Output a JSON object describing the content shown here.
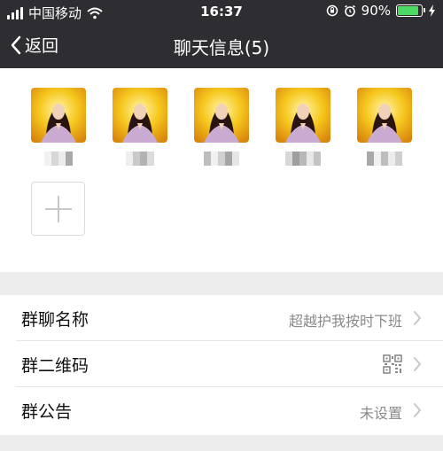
{
  "status_bar": {
    "carrier": "中国移动",
    "time": "16:37",
    "battery": "90%",
    "battery_level": 0.9,
    "icons": [
      "signal-icon",
      "wifi-icon",
      "rotation-lock-icon",
      "alarm-icon",
      "battery-icon",
      "charging-icon"
    ]
  },
  "nav": {
    "back_label": "返回",
    "title": "聊天信息(5)"
  },
  "members": {
    "count": 5,
    "add_icon": "plus-icon"
  },
  "settings": {
    "rows": [
      {
        "label": "群聊名称",
        "value": "超越护我按时下班"
      },
      {
        "label": "群二维码",
        "icon": "qr-code-icon"
      },
      {
        "label": "群公告",
        "value": "未设置"
      }
    ]
  },
  "colors": {
    "header_bg": "#2e2e32",
    "page_bg": "#ededed",
    "battery_green": "#4cd964"
  }
}
